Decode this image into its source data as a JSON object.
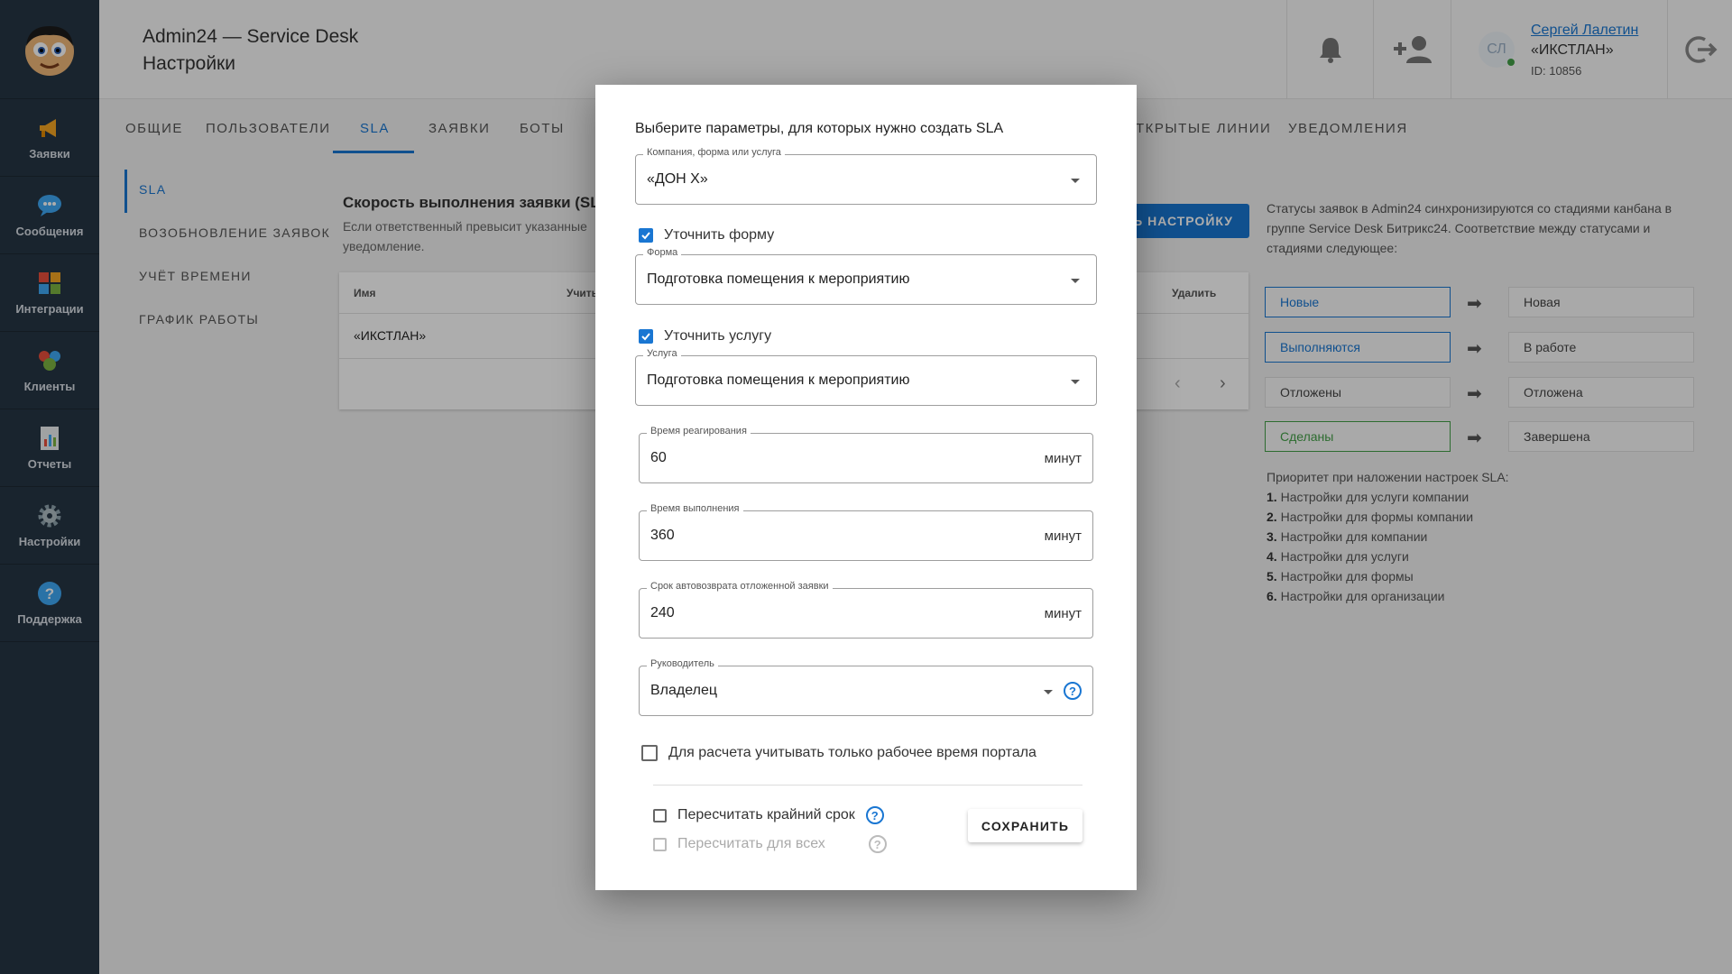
{
  "header": {
    "app_title": "Admin24 — Service Desk",
    "page_title": "Настройки",
    "user": {
      "initials": "СЛ",
      "name": "Сергей Лалетин",
      "org": "«ИКСТЛАН»",
      "id": "ID: 10856"
    }
  },
  "sidebar": {
    "items": [
      {
        "label": "Заявки",
        "icon": "megaphone-icon"
      },
      {
        "label": "Сообщения",
        "icon": "chat-icon"
      },
      {
        "label": "Интеграции",
        "icon": "puzzle-icon"
      },
      {
        "label": "Клиенты",
        "icon": "clients-icon"
      },
      {
        "label": "Отчеты",
        "icon": "report-icon"
      },
      {
        "label": "Настройки",
        "icon": "gear-icon"
      },
      {
        "label": "Поддержка",
        "icon": "help-icon"
      }
    ]
  },
  "tabs": [
    "ОБЩИЕ",
    "ПОЛЬЗОВАТЕЛИ",
    "SLA",
    "ЗАЯВКИ",
    "БОТЫ",
    "ТКРЫТЫЕ ЛИНИИ",
    "УВЕДОМЛЕНИЯ"
  ],
  "side_nav": [
    "SLA",
    "ВОЗОБНОВЛЕНИЕ ЗАЯВОК",
    "УЧЁТ ВРЕМЕНИ",
    "ГРАФИК РАБОТЫ"
  ],
  "main": {
    "title": "Скорость выполнения заявки (SLA)",
    "desc": "Если ответственный превысит указанные уведомление.",
    "add_button": "Ь НАСТРОЙКУ",
    "table": {
      "col_name": "Имя",
      "col_consider": "Учиты",
      "col_delete": "Удалить",
      "row_name": "«ИКСТЛАН»"
    }
  },
  "right_panel": {
    "desc": "Статусы заявок в Admin24 синхронизируются со стадиями канбана в группе Service Desk Битрикс24. Соответствие между статусами и стадиями следующее:",
    "mapping": [
      {
        "from": "Новые",
        "to": "Новая",
        "color": "#1976d2"
      },
      {
        "from": "Выполняются",
        "to": "В работе",
        "color": "#1976d2"
      },
      {
        "from": "Отложены",
        "to": "Отложена",
        "color": "#444444"
      },
      {
        "from": "Сделаны",
        "to": "Завершена",
        "color": "#43a047"
      }
    ],
    "priority_title": "Приоритет при наложении настроек SLA:",
    "priority": [
      {
        "n": "1.",
        "t": "Настройки для услуги компании"
      },
      {
        "n": "2.",
        "t": "Настройки для формы компании"
      },
      {
        "n": "3.",
        "t": "Настройки для компании"
      },
      {
        "n": "4.",
        "t": "Настройки для услуги"
      },
      {
        "n": "5.",
        "t": "Настройки для формы"
      },
      {
        "n": "6.",
        "t": "Настройки для организации"
      }
    ]
  },
  "modal": {
    "title": "Выберите параметры, для которых нужно создать SLA",
    "company": {
      "label": "Компания, форма или услуга",
      "value": "«ДОН Х»"
    },
    "refine_form": {
      "label": "Уточнить форму",
      "checked": true
    },
    "form": {
      "label": "Форма",
      "value": "Подготовка помещения к мероприятию"
    },
    "refine_service": {
      "label": "Уточнить услугу",
      "checked": true
    },
    "service": {
      "label": "Услуга",
      "value": "Подготовка помещения к мероприятию"
    },
    "reaction": {
      "label": "Время реагирования",
      "value": "60",
      "unit": "минут"
    },
    "execution": {
      "label": "Время выполнения",
      "value": "360",
      "unit": "минут"
    },
    "autoreturn": {
      "label": "Срок автовозврата отложенной заявки",
      "value": "240",
      "unit": "минут"
    },
    "manager": {
      "label": "Руководитель",
      "value": "Владелец"
    },
    "work_time": {
      "label": "Для расчета учитывать только рабочее время портала",
      "checked": false
    },
    "recalc_deadline": {
      "label": "Пересчитать крайний срок",
      "checked": false
    },
    "recalc_all": {
      "label": "Пересчитать для всех",
      "checked": false
    },
    "save": "СОХРАНИТЬ"
  }
}
